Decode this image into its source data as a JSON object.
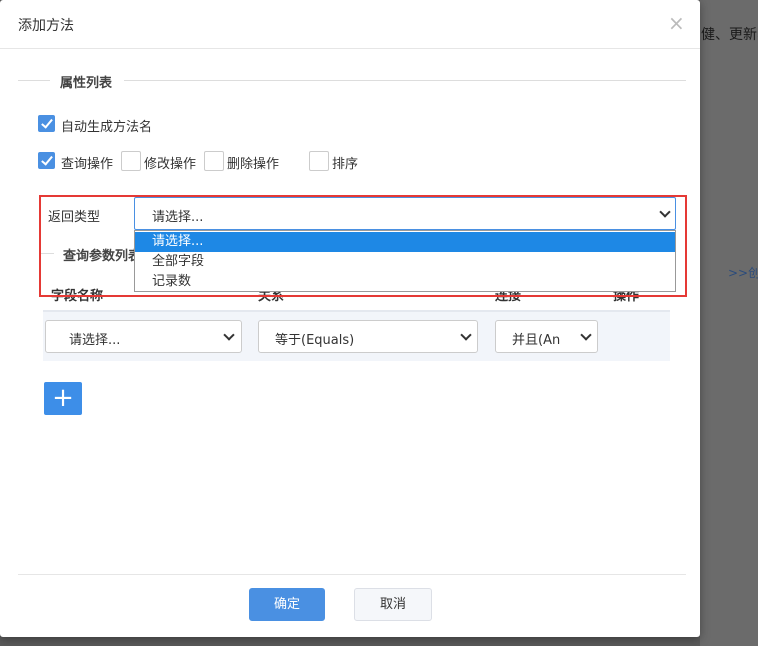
{
  "background": {
    "text_top": "健、更新、",
    "link_text": ">>创"
  },
  "dialog": {
    "title": "添加方法",
    "close_symbol": "×"
  },
  "attributes": {
    "legend": "属性列表",
    "auto_name": {
      "label": "自动生成方法名",
      "checked": true
    },
    "operations": [
      {
        "label": "查询操作",
        "checked": true
      },
      {
        "label": "修改操作",
        "checked": false
      },
      {
        "label": "删除操作",
        "checked": false
      },
      {
        "label": "排序",
        "checked": false
      }
    ]
  },
  "return_type": {
    "label": "返回类型",
    "value": "请选择...",
    "options": [
      "请选择...",
      "全部字段",
      "记录数"
    ],
    "selected_index": 0
  },
  "query_params": {
    "legend": "查询参数列表",
    "columns": [
      "字段名称",
      "关系",
      "连接",
      "操作"
    ],
    "row": {
      "field": "请选择...",
      "relation": "等于(Equals)",
      "connector": "并且(An"
    }
  },
  "add_button": {
    "symbol": "+"
  },
  "footer": {
    "confirm_label": "确定",
    "cancel_label": "取消"
  },
  "colors": {
    "primary": "#4a90e2",
    "highlight": "#1e88e5",
    "annotation": "#e53935"
  }
}
